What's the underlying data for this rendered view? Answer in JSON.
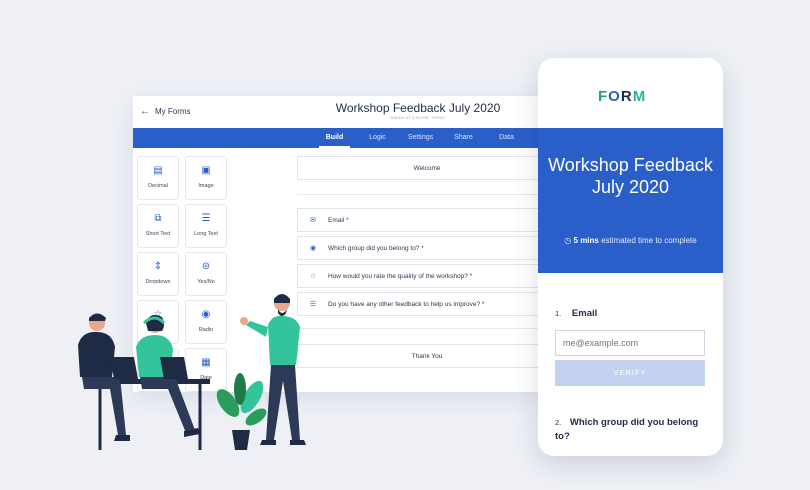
{
  "builder": {
    "back_label": "My Forms",
    "title": "Workshop Feedback July 2020",
    "subtitle": "SAVED AT 4:00 PM, TODAY",
    "tabs": [
      "Build",
      "Logic",
      "Settings",
      "Share",
      "Data"
    ],
    "active_tab": "Build",
    "palette": [
      {
        "label": "Decimal",
        "icon": "decimal-icon"
      },
      {
        "label": "Image",
        "icon": "image-icon"
      },
      {
        "label": "Short Text",
        "icon": "short-text-icon"
      },
      {
        "label": "Long Text",
        "icon": "long-text-icon"
      },
      {
        "label": "Dropdown",
        "icon": "dropdown-icon"
      },
      {
        "label": "Yes/No",
        "icon": "toggle-icon"
      },
      {
        "label": "",
        "icon": "rating-icon"
      },
      {
        "label": "Radio",
        "icon": "radio-icon"
      },
      {
        "label": "",
        "icon": "blank-icon"
      },
      {
        "label": "Date",
        "icon": "calendar-icon"
      }
    ],
    "fields": {
      "welcome": "Welcome",
      "email": "Email *",
      "group": "Which group did you belong to? *",
      "rating": "How would you rate the quality of the workshop? *",
      "feedback": "Do you have any other feedback to help us improve? *",
      "thanks": "Thank You"
    }
  },
  "phone": {
    "logo": [
      "F",
      "O",
      "R",
      "M"
    ],
    "form_title": "Workshop Feedback July 2020",
    "time_bold": "5 mins",
    "time_rest": "estimated time to complete",
    "q1_number": "1.",
    "q1_label": "Email",
    "email_placeholder": "me@example.com",
    "verify_label": "VERIFY",
    "q2_number": "2.",
    "q2_label": "Which group did you belong to?"
  },
  "colors": {
    "primary": "#2a5fc9",
    "teal": "#1f9e8a",
    "background": "#eef0f6"
  }
}
